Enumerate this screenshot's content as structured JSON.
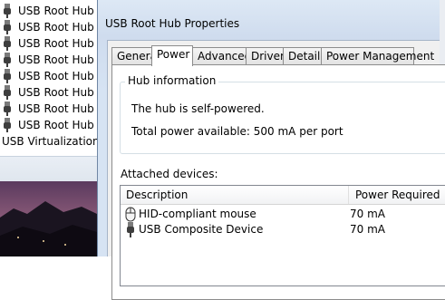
{
  "background_tree": {
    "items": [
      {
        "label": "USB Root Hub",
        "icon": "usb-plug-icon"
      },
      {
        "label": "USB Root Hub",
        "icon": "usb-plug-icon"
      },
      {
        "label": "USB Root Hub",
        "icon": "usb-plug-icon"
      },
      {
        "label": "USB Root Hub",
        "icon": "usb-plug-icon"
      },
      {
        "label": "USB Root Hub",
        "icon": "usb-plug-icon"
      },
      {
        "label": "USB Root Hub",
        "icon": "usb-plug-icon"
      },
      {
        "label": "USB Root Hub",
        "icon": "usb-plug-icon"
      },
      {
        "label": "USB Root Hub",
        "icon": "usb-plug-icon"
      }
    ],
    "last_item": {
      "label": "USB Virtualization"
    }
  },
  "window": {
    "title": "USB Root Hub Properties",
    "tabs": [
      {
        "label": "General",
        "active": false
      },
      {
        "label": "Power",
        "active": true
      },
      {
        "label": "Advanced",
        "active": false
      },
      {
        "label": "Driver",
        "active": false
      },
      {
        "label": "Details",
        "active": false
      },
      {
        "label": "Power Management",
        "active": false
      }
    ]
  },
  "power_tab": {
    "hub_info": {
      "legend": "Hub information",
      "self_powered": "The hub is self-powered.",
      "total_power": "Total power available:  500 mA per port"
    },
    "attached_label": "Attached devices:",
    "columns": {
      "description": "Description",
      "power": "Power Required"
    },
    "devices": [
      {
        "description": "HID-compliant mouse",
        "power": "70 mA",
        "icon": "mouse-icon"
      },
      {
        "description": "USB Composite Device",
        "power": "70 mA",
        "icon": "usb-plug-icon"
      }
    ]
  },
  "colors": {
    "window_frame": "#d5e2f2",
    "tab_panel": "#ffffff",
    "client_bg": "#f0f0f0"
  }
}
